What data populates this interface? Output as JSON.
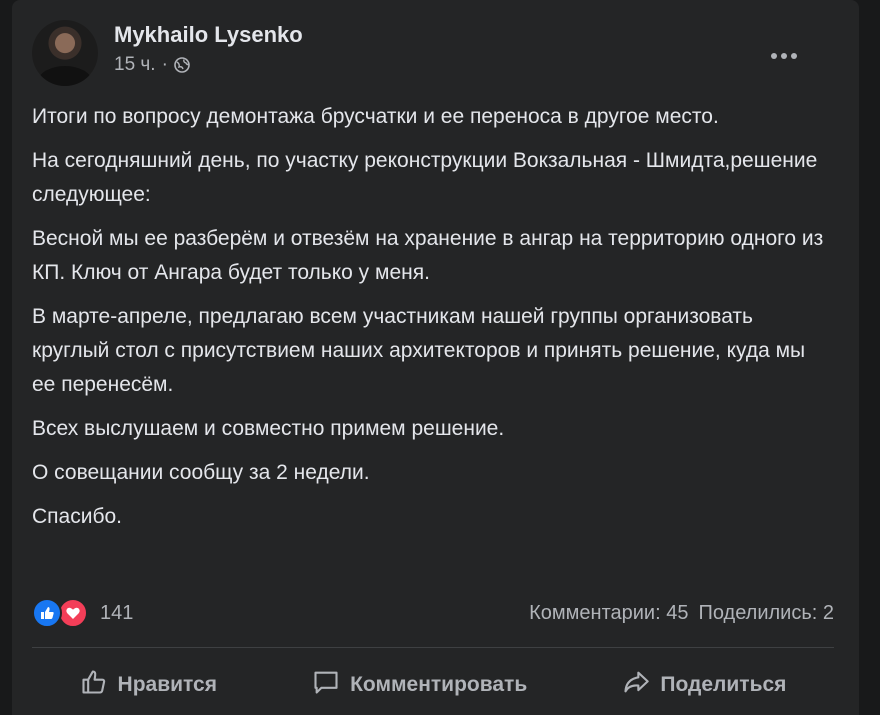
{
  "post": {
    "author": "Mykhailo Lysenko",
    "time": "15 ч.",
    "separator": "·",
    "privacy_icon": "globe-icon",
    "paragraphs": [
      "Итоги по вопросу демонтажа брусчатки и ее переноса в другое место.",
      "На сегодняшний день, по участку реконструкции Вокзальная - Шмидта,решение следующее:",
      "Весной мы ее разберём и отвезём на хранение в ангар на территорию одного из КП. Ключ от Ангара будет только у меня.",
      "В марте-апреле, предлагаю всем участникам нашей группы организовать круглый стол с присутствием наших архитекторов и принять решение, куда мы ее перенесём.",
      "Всех выслушаем и совместно примем решение.",
      "О совещании сообщу за 2 недели.",
      "Спасибо."
    ]
  },
  "stats": {
    "reactions_count": "141",
    "comments": "Комментарии: 45",
    "shares": "Поделились: 2"
  },
  "actions": {
    "like": "Нравится",
    "comment": "Комментировать",
    "share": "Поделиться"
  },
  "colors": {
    "background": "#18191a",
    "card": "#242526",
    "text": "#e4e6eb",
    "secondary": "#b0b3b8",
    "like_blue": "#1877f2",
    "love_red": "#f33e58"
  }
}
